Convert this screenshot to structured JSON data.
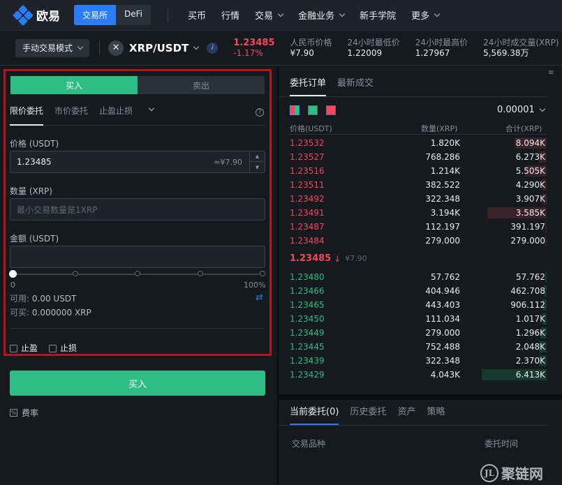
{
  "brand": {
    "name": "欧易"
  },
  "header": {
    "segment": [
      "交易所",
      "DeFi"
    ],
    "nav": [
      "买币",
      "行情",
      "交易",
      "金融业务",
      "新手学院",
      "更多"
    ]
  },
  "ticker": {
    "mode": "手动交易模式",
    "coin_glyph": "✕",
    "pair": "XRP/USDT",
    "info": "i",
    "price": "1.23485",
    "change": "-1.17%",
    "stats": [
      {
        "label": "人民币价格",
        "value": "¥7.90"
      },
      {
        "label": "24小时最低价",
        "value": "1.22009"
      },
      {
        "label": "24小时最高价",
        "value": "1.27967"
      },
      {
        "label": "24小时成交量(XRP)",
        "value": "5,569.38万"
      }
    ]
  },
  "order_form": {
    "buy_tab": "买入",
    "sell_tab": "卖出",
    "order_types": [
      "限价委托",
      "市价委托",
      "止盈止损"
    ],
    "help": "?",
    "price_label": "价格 (USDT)",
    "price_value": "1.23485",
    "price_approx": "≈¥7.90",
    "qty_label": "数量 (XRP)",
    "qty_placeholder": "最小交易数量是1XRP",
    "amount_label": "金额 (USDT)",
    "slider_min": "0",
    "slider_max": "100%",
    "slider_fraction": 0,
    "available_label": "可用:",
    "available_value": "0.00 USDT",
    "can_buy_label": "可买:",
    "can_buy_value": "0.000000 XRP",
    "take_profit": "止盈",
    "stop_loss": "止损",
    "submit": "买入",
    "fee": "费率"
  },
  "order_book": {
    "tabs": [
      "委托订单",
      "最新成交"
    ],
    "precision": "0.00001",
    "headers": [
      "价格(USDT)",
      "数量(XRP)",
      "合计(XRP)"
    ],
    "asks": [
      {
        "price": "1.23532",
        "qty": "1.820K",
        "total": "8.094K",
        "depth": 0.25
      },
      {
        "price": "1.23527",
        "qty": "768.286",
        "total": "6.273K",
        "depth": 0.06
      },
      {
        "price": "1.23516",
        "qty": "1.214K",
        "total": "5.505K",
        "depth": 0.17
      },
      {
        "price": "1.23511",
        "qty": "382.522",
        "total": "4.290K",
        "depth": 0.04
      },
      {
        "price": "1.23492",
        "qty": "322.348",
        "total": "3.907K",
        "depth": 0.03
      },
      {
        "price": "1.23491",
        "qty": "3.194K",
        "total": "3.585K",
        "depth": 0.46
      },
      {
        "price": "1.23487",
        "qty": "112.197",
        "total": "391.197",
        "depth": 0.01
      },
      {
        "price": "1.23484",
        "qty": "279.000",
        "total": "279.000",
        "depth": 0.01
      }
    ],
    "mid_price": "1.23485",
    "mid_arrow": "↓",
    "mid_cny": "¥7.90",
    "bids": [
      {
        "price": "1.23480",
        "qty": "57.762",
        "total": "57.762",
        "depth": 0.01
      },
      {
        "price": "1.23466",
        "qty": "404.946",
        "total": "462.708",
        "depth": 0.02
      },
      {
        "price": "1.23465",
        "qty": "443.403",
        "total": "906.112",
        "depth": 0.03
      },
      {
        "price": "1.23450",
        "qty": "111.034",
        "total": "1.017K",
        "depth": 0.03
      },
      {
        "price": "1.23449",
        "qty": "279.000",
        "total": "1.296K",
        "depth": 0.05
      },
      {
        "price": "1.23445",
        "qty": "752.488",
        "total": "2.048K",
        "depth": 0.06
      },
      {
        "price": "1.23439",
        "qty": "322.348",
        "total": "2.370K",
        "depth": 0.06
      },
      {
        "price": "1.23429",
        "qty": "4.043K",
        "total": "6.413K",
        "depth": 0.5
      }
    ]
  },
  "orders_panel": {
    "tabs": [
      "当前委托(0)",
      "历史委托",
      "资产",
      "策略"
    ],
    "columns": [
      "交易品种",
      "委托时间"
    ]
  },
  "watermark": "聚链网"
}
